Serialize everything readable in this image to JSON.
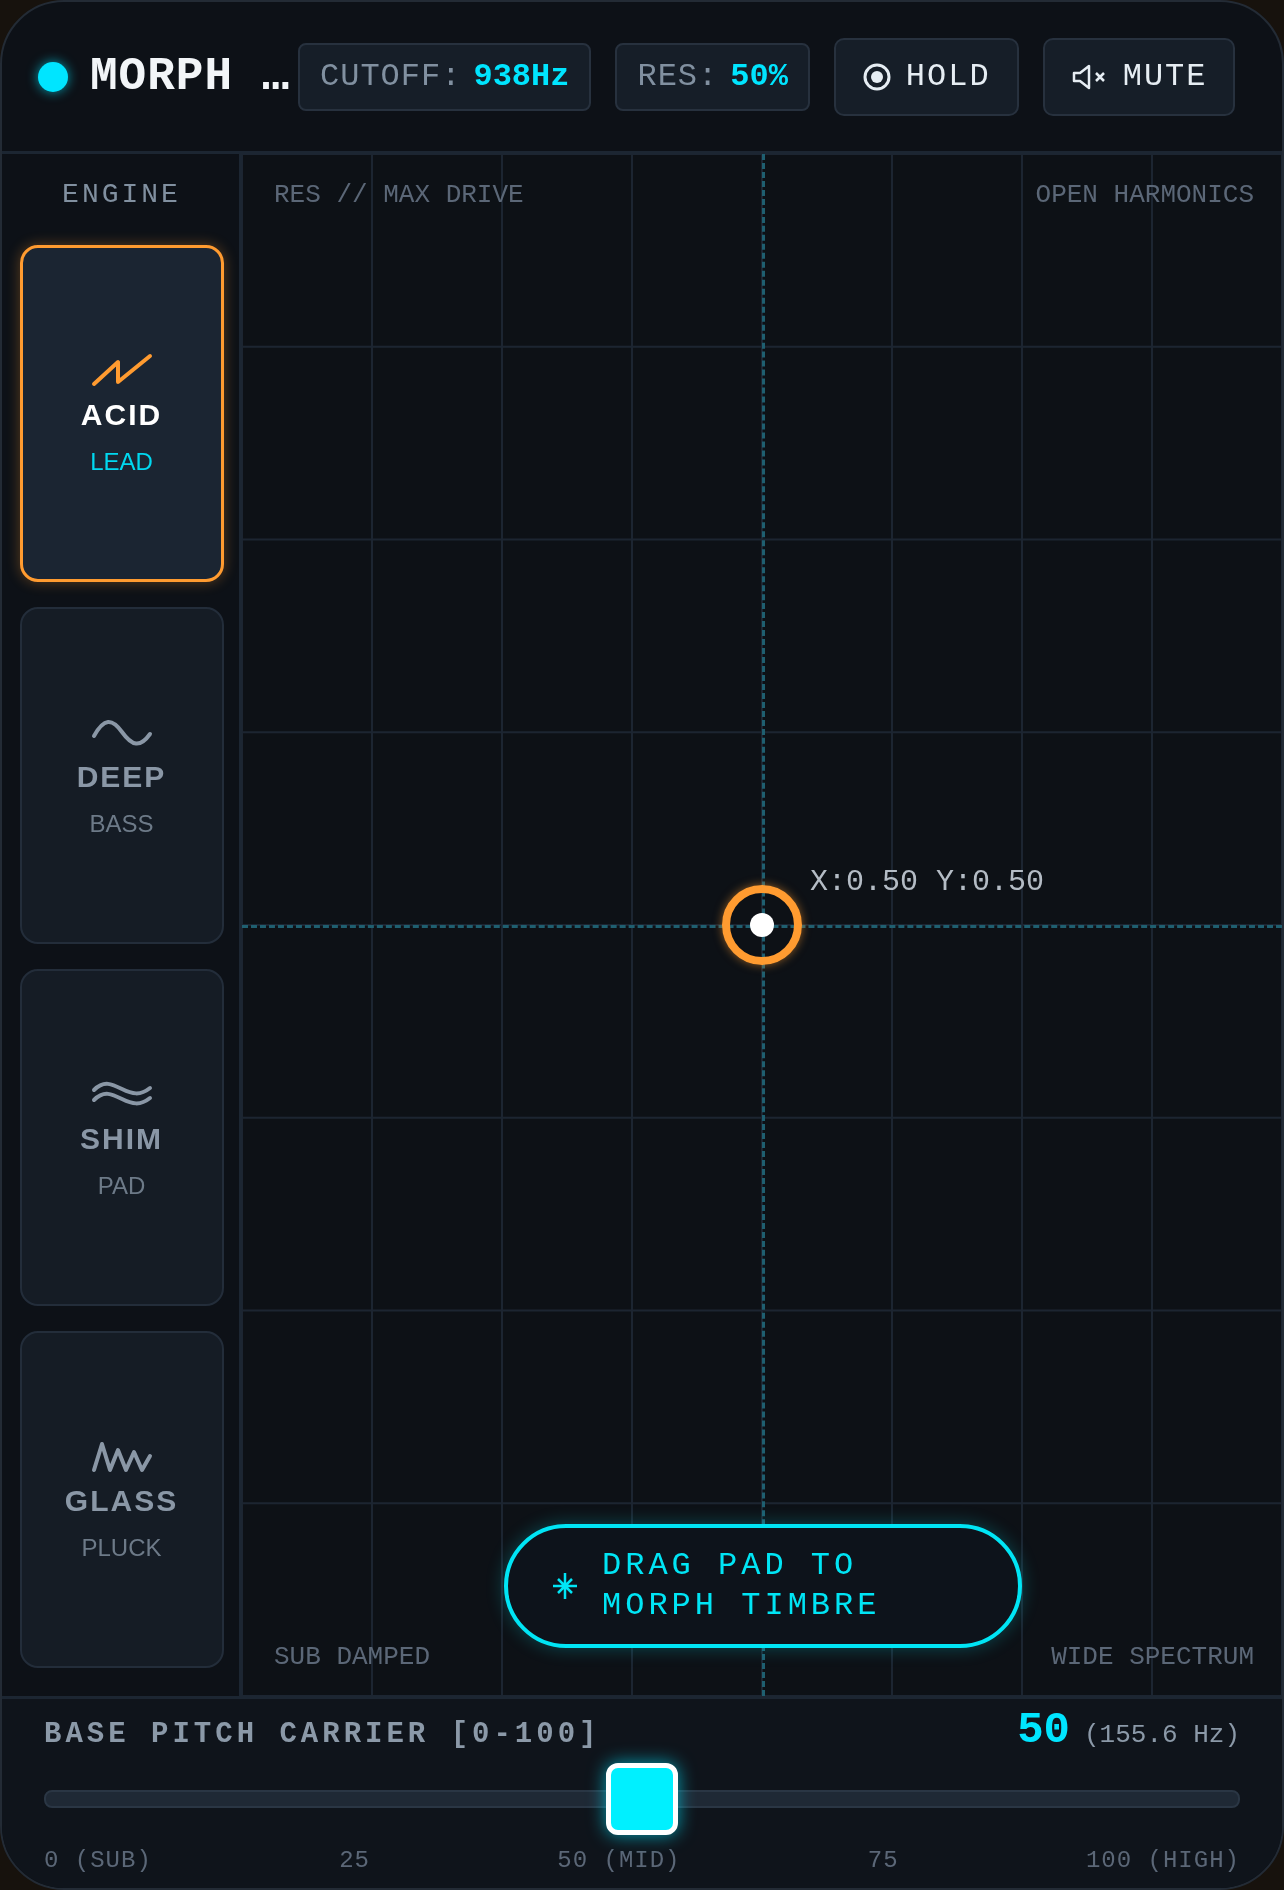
{
  "header": {
    "status": {
      "on": true
    },
    "title": "MORPH …",
    "readouts": [
      {
        "label": "CUTOFF:",
        "value": "938Hz"
      },
      {
        "label": "RES:",
        "value": "50%"
      }
    ],
    "buttons": [
      {
        "kind": "hold",
        "label": "HOLD"
      },
      {
        "kind": "mute",
        "label": "MUTE"
      }
    ]
  },
  "sidebar": {
    "title": "ENGINE",
    "engines": [
      {
        "kind": "saw",
        "name": "ACID",
        "sub": "LEAD",
        "selected": true
      },
      {
        "kind": "sine",
        "name": "DEEP",
        "sub": "BASS",
        "selected": false
      },
      {
        "kind": "wave",
        "name": "SHIM",
        "sub": "PAD",
        "selected": false
      },
      {
        "kind": "zigzag",
        "name": "GLASS",
        "sub": "PLUCK",
        "selected": false
      }
    ]
  },
  "pad": {
    "top_left": "RES // MAX DRIVE",
    "top_right": "OPEN HARMONICS",
    "bottom_left": "SUB DAMPED",
    "bottom_right": "WIDE SPECTRUM",
    "coords": "X:0.50 Y:0.50",
    "hint": "DRAG PAD TO MORPH TIMBRE"
  },
  "slider": {
    "label": "BASE PITCH CARRIER [0-100]",
    "value": "50",
    "hz": "(155.6 Hz)",
    "level": 0.5,
    "ticks": [
      "0 (SUB)",
      "25",
      "50 (MID)",
      "75",
      "100 (HIGH)"
    ]
  }
}
